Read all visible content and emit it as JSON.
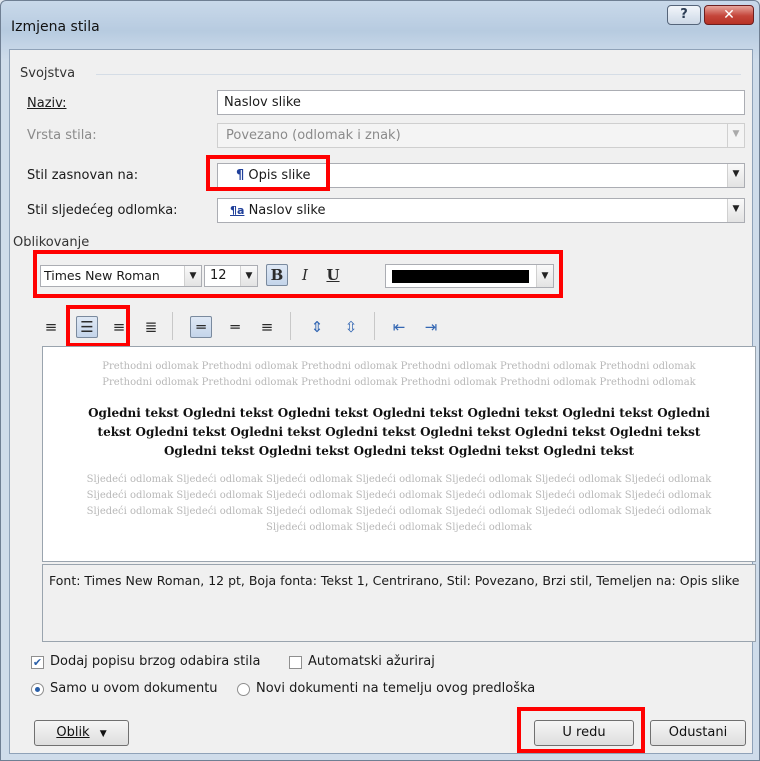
{
  "window": {
    "title": "Izmjena stila",
    "help_glyph": "?",
    "close_glyph": "✕"
  },
  "svojstva": {
    "group_title": "Svojstva",
    "naziv_label": "Naziv:",
    "naziv_value": "Naslov slike",
    "vrsta_label": "Vrsta stila:",
    "vrsta_value": "Povezano (odlomak i znak)",
    "zasnovan_label": "Stil zasnovan na:",
    "zasnovan_glyph": "¶",
    "zasnovan_value": "Opis slike",
    "sljedeci_label": "Stil sljedećeg odlomka:",
    "sljedeci_glyph": "¶a",
    "sljedeci_value": "Naslov slike"
  },
  "oblikovanje": {
    "group_title": "Oblikovanje",
    "font_name": "Times New Roman",
    "font_size": "12",
    "bold": "B",
    "italic": "I",
    "underline": "U",
    "font_color": "#000000"
  },
  "preview": {
    "previous_text": "Prethodni odlomak Prethodni odlomak Prethodni odlomak Prethodni odlomak Prethodni odlomak Prethodni odlomak Prethodni odlomak Prethodni odlomak Prethodni odlomak Prethodni odlomak Prethodni odlomak Prethodni odlomak",
    "sample_text": "Ogledni tekst Ogledni tekst Ogledni tekst Ogledni tekst Ogledni tekst Ogledni tekst Ogledni tekst Ogledni tekst Ogledni tekst Ogledni tekst Ogledni tekst Ogledni tekst Ogledni tekst Ogledni tekst Ogledni tekst Ogledni tekst Ogledni tekst Ogledni tekst",
    "next_text": "Sljedeći odlomak Sljedeći odlomak Sljedeći odlomak Sljedeći odlomak Sljedeći odlomak Sljedeći odlomak Sljedeći odlomak Sljedeći odlomak Sljedeći odlomak Sljedeći odlomak Sljedeći odlomak Sljedeći odlomak Sljedeći odlomak Sljedeći odlomak Sljedeći odlomak Sljedeći odlomak Sljedeći odlomak Sljedeći odlomak Sljedeći odlomak Sljedeći odlomak Sljedeći odlomak Sljedeći odlomak Sljedeći odlomak Sljedeći odlomak"
  },
  "description": "Font: Times New Roman, 12 pt, Boja fonta: Tekst 1, Centrirano, Stil: Povezano, Brzi stil, Temeljen na: Opis slike",
  "options": {
    "quick_style_label": "Dodaj popisu brzog odabira stila",
    "quick_style_checked": true,
    "auto_update_label": "Automatski ažuriraj",
    "auto_update_checked": false,
    "only_doc_label": "Samo u ovom dokumentu",
    "new_docs_label": "Novi dokumenti na temelju ovog predloška",
    "selected_scope": "Samo u ovom dokumentu"
  },
  "buttons": {
    "format": "Oblik",
    "format_arrow": "▼",
    "ok": "U redu",
    "cancel": "Odustani"
  },
  "colors": {
    "highlight": "#ff0000",
    "accent": "#2a5fa8"
  }
}
